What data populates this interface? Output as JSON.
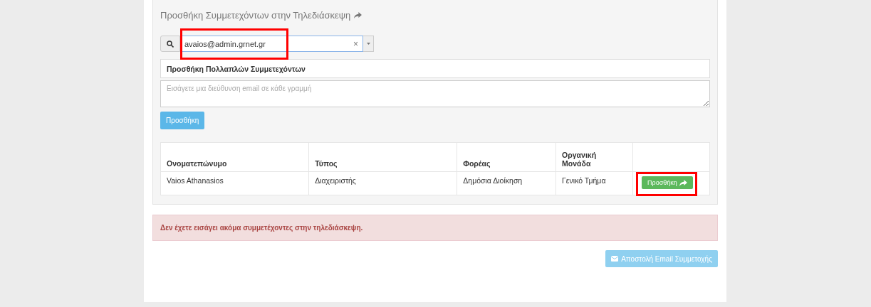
{
  "panel": {
    "title": "Προσθήκη Συμμετεχόντων στην Τηλεδιάσκεψη",
    "search": {
      "value": "avaios@admin.grnet.gr",
      "highlighted": true,
      "clear": "×"
    },
    "multi_label": "Προσθήκη Πολλαπλών Συμμετεχόντων",
    "emails": {
      "placeholder": "Εισάγετε μια διεύθυνση email σε κάθε γραμμή"
    },
    "add_button": "Προσθήκη",
    "table": {
      "columns": [
        "Ονοματεπώνυμο",
        "Τύπος",
        "Φορέας",
        "Οργανική Μονάδα"
      ],
      "rows": [
        {
          "cells": [
            "Vaios Athanasios",
            "Διαχειριστής",
            "Δημόσια Διοίκηση",
            "Γενικό Τμήμα"
          ],
          "action": "Προσθήκη",
          "highlighted": true
        }
      ]
    }
  },
  "alert": "Δεν έχετε εισάγει ακόμα συμμετέχοντες στην τηλεδιάσκεψη.",
  "send_button": {
    "label": "Αποστολή Email Συμμετοχής",
    "disabled": true
  }
}
